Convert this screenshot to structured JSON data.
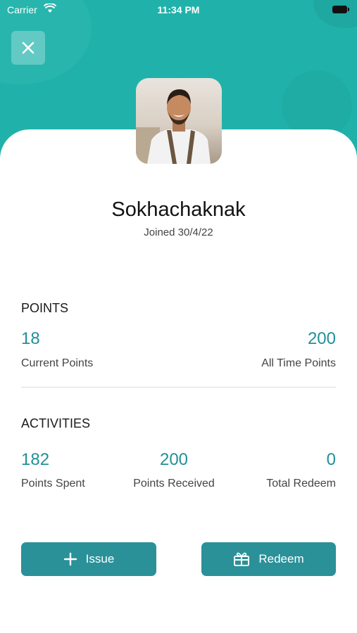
{
  "status_bar": {
    "carrier": "Carrier",
    "time": "11:34 PM"
  },
  "icons": {
    "close": "close-icon",
    "wifi": "wifi-icon",
    "battery": "battery-icon",
    "plus": "plus-icon",
    "gift": "gift-icon"
  },
  "colors": {
    "header": "#20b2aa",
    "accent": "#228f97",
    "button": "#2a9199"
  },
  "profile": {
    "name": "Sokhachaknak",
    "joined": "Joined 30/4/22"
  },
  "points": {
    "title": "POINTS",
    "current_value": "18",
    "current_label": "Current Points",
    "all_time_value": "200",
    "all_time_label": "All Time Points"
  },
  "activities": {
    "title": "ACTIVITIES",
    "spent_value": "182",
    "spent_label": "Points Spent",
    "received_value": "200",
    "received_label": "Points Received",
    "redeem_value": "0",
    "redeem_label": "Total Redeem"
  },
  "actions": {
    "issue_label": "Issue",
    "redeem_label": "Redeem"
  }
}
